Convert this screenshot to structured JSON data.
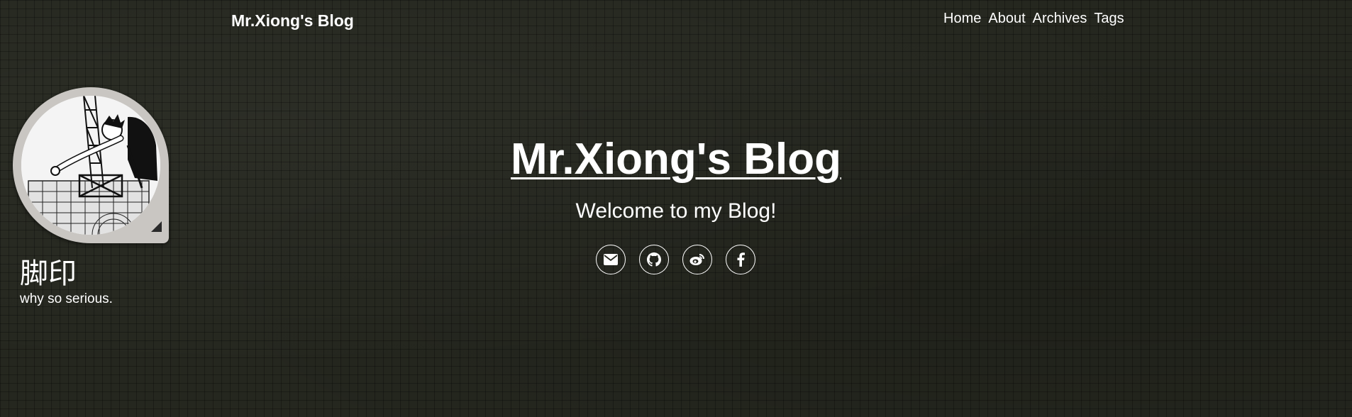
{
  "navbar": {
    "brand": "Mr.Xiong's Blog",
    "links": [
      {
        "label": "Home"
      },
      {
        "label": "About"
      },
      {
        "label": "Archives"
      },
      {
        "label": "Tags"
      }
    ]
  },
  "profile": {
    "name": "脚印",
    "motto": "why so serious."
  },
  "hero": {
    "title": "Mr.Xiong's Blog",
    "subtitle": "Welcome to my Blog!"
  },
  "social": [
    {
      "icon": "envelope-icon"
    },
    {
      "icon": "github-icon"
    },
    {
      "icon": "weibo-icon"
    },
    {
      "icon": "facebook-icon"
    }
  ],
  "colors": {
    "background": "#25271f",
    "text": "#ffffff",
    "avatar_frame": "#c9c6c2"
  }
}
